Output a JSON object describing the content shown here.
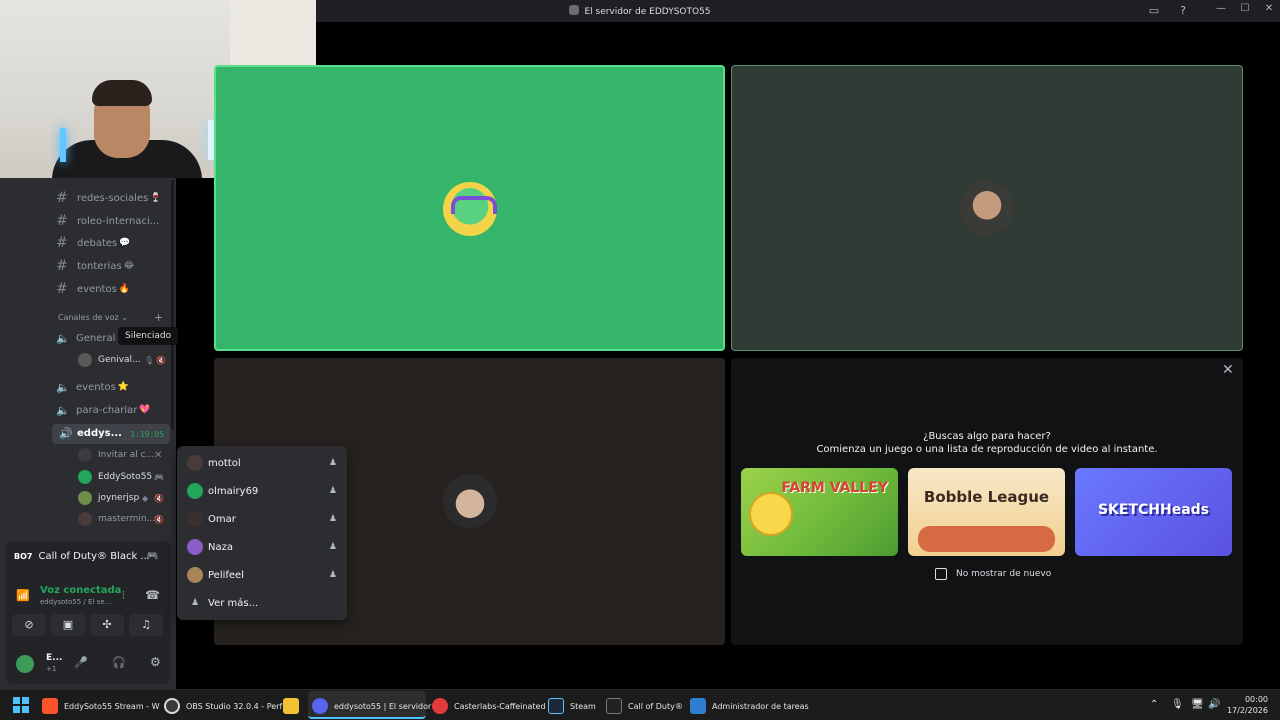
{
  "window": {
    "title": "El servidor de EDDYSOTO55",
    "controls": [
      "—",
      "☐",
      "✕"
    ]
  },
  "sidebar": {
    "text_channels": [
      {
        "name": "redes-sociales",
        "emoji": "🍷"
      },
      {
        "name": "roleo-internaci...",
        "emoji": ""
      },
      {
        "name": "debates",
        "emoji": "💬"
      },
      {
        "name": "tonterias",
        "emoji": "😂"
      },
      {
        "name": "eventos",
        "emoji": "🔥"
      }
    ],
    "voice_category": "Canales de voz",
    "voice_channels": {
      "general": "General",
      "eventos": "eventos",
      "eventos_emoji": "⭐",
      "para_charlar": "para-charlar",
      "para_charlar_emoji": "💖",
      "active": "eddys...",
      "active_timer": "1:19:05"
    },
    "general_members": [
      {
        "name": "Genival..."
      }
    ],
    "active_members": [
      {
        "name": "Invitar al c..."
      },
      {
        "name": "EddySoto55"
      },
      {
        "name": "joynerjsp"
      },
      {
        "name": "mastermin..."
      }
    ],
    "tooltip": "Silenciado"
  },
  "panel": {
    "game": "Call of Duty® Black ...",
    "game_logo": "BO7",
    "voice_status": "Voz conectada",
    "voice_sub": "eddysoto55 / El se...",
    "user_name": "E...",
    "user_status": "+1"
  },
  "popup": {
    "members": [
      "mottol",
      "olmairy69",
      "Omar",
      "Naza",
      "Pelifeel"
    ],
    "more": "Ver más..."
  },
  "activity": {
    "line1": "¿Buscas algo para hacer?",
    "line2": "Comienza un juego o una lista de reproducción de video al instante.",
    "games": [
      "FARM VALLEY",
      "Bobble League",
      "SKETCHHeads"
    ],
    "no_show": "No mostrar de nuevo"
  },
  "taskbar": {
    "items": [
      {
        "label": "EddySoto55 Stream - W",
        "color": "#fb542b"
      },
      {
        "label": "OBS Studio 32.0.4 - Perf",
        "color": "#3a3a3a"
      },
      {
        "label": "",
        "color": "#f2c230"
      },
      {
        "label": "eddysoto55 | El servidor",
        "color": "#5865f2"
      },
      {
        "label": "Casterlabs-Caffeinated",
        "color": "#e23b3b"
      },
      {
        "label": "Steam",
        "color": "#1b2838"
      },
      {
        "label": "Call of Duty®",
        "color": "#222222"
      },
      {
        "label": "Administrador de tareas",
        "color": "#2f7fd1"
      }
    ],
    "time": "00:00",
    "date": "17/2/2026"
  },
  "colors": {
    "accent_green": "#23a55a",
    "discord_blurple": "#5865f2",
    "speaking_border": "#5be08a"
  }
}
